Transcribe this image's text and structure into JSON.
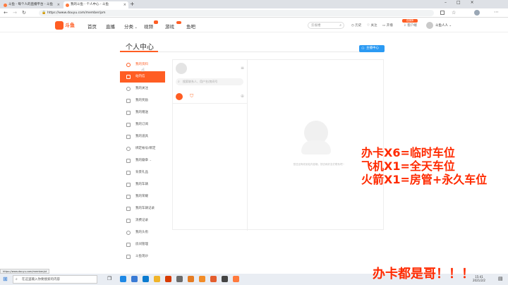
{
  "browser": {
    "tabs": [
      {
        "title": "斗鱼 - 每个人的直播平台 - 斗鱼",
        "active": false
      },
      {
        "title": "我的斗鱼 - 个人中心 - 斗鱼",
        "active": true
      }
    ],
    "url": "https://www.douyu.com/member/pm"
  },
  "site": {
    "logo": "斗鱼",
    "nav": [
      "首页",
      "直播",
      "分类",
      "视频",
      "游戏",
      "鱼吧"
    ],
    "search_placeholder": "云雀楼",
    "right_links": [
      "历史",
      "关注",
      "开播",
      "客户端"
    ],
    "badge": "自媒体",
    "username": "斗鱼人人"
  },
  "page": {
    "title": "个人中心",
    "anchor_button": "主播中心",
    "sidebar": [
      "我的资料",
      "站内信",
      "我的关注",
      "我的奖励",
      "我的赠送",
      "我的订阅",
      "我的道具",
      "绑定帐号/绑定",
      "我的徽章",
      "背景礼品",
      "我的车辆",
      "我的荣耀",
      "我的车辆记录",
      "消费记录",
      "我的头衔",
      "房间管理",
      "斗鱼现炒"
    ],
    "active_item": "站内信",
    "message_search_placeholder": "搜索联系人、用户名/房间号",
    "empty_text": "您还没有收到站内信哦，快去和好友们联系吧~"
  },
  "overlay": {
    "lines": [
      "办卡X6=临时车位",
      "飞机X1=全天车位",
      "火箭X1=房管+永久车位"
    ],
    "footer": "办卡都是哥！！！"
  },
  "status_url": "https://www.douyu.com/member/pt",
  "taskbar": {
    "search_placeholder": "在这里输入你要搜索的内容",
    "time": "15:41",
    "date": "2021/2/2"
  },
  "colors": {
    "accent": "#ff5d23",
    "overlay_red": "#ff2a00",
    "blue": "#2b9af3"
  }
}
